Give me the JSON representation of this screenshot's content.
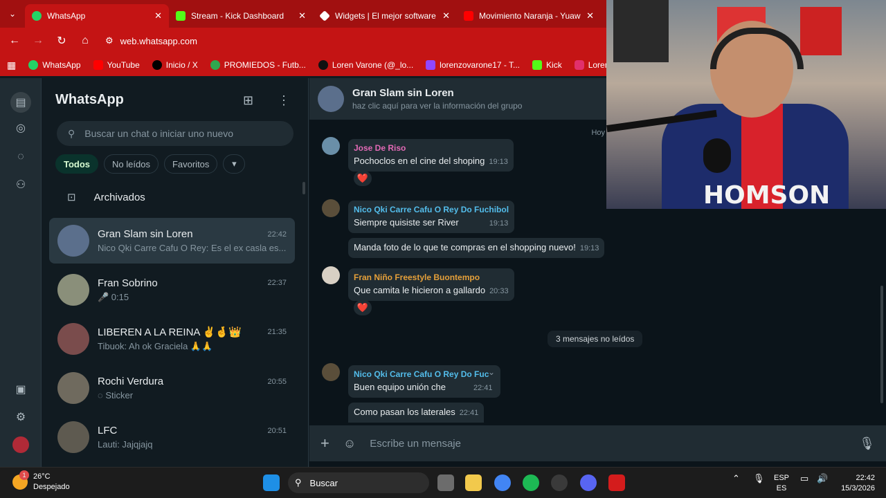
{
  "browser": {
    "tabs": [
      {
        "title": "WhatsApp",
        "color": "#25d366",
        "active": true
      },
      {
        "title": "Stream - Kick Dashboard",
        "color": "#53fc18",
        "active": false
      },
      {
        "title": "Widgets | El mejor software para ...",
        "color": "#ffffff",
        "active": false
      },
      {
        "title": "Movimiento Naranja - Yuawn...",
        "color": "#ff0000",
        "active": false
      }
    ],
    "close_glyph": "✕",
    "url": "web.whatsapp.com",
    "bookmarks": [
      {
        "label": "WhatsApp",
        "color": "#25d366"
      },
      {
        "label": "YouTube",
        "color": "#ff0000"
      },
      {
        "label": "Inicio / X",
        "color": "#000000"
      },
      {
        "label": "PROMIEDOS - Futb...",
        "color": "#2fa84f"
      },
      {
        "label": "Loren Varone (@_lo...",
        "color": "#111111"
      },
      {
        "label": "lorenzovarone17 - T...",
        "color": "#9146ff"
      },
      {
        "label": "Kick",
        "color": "#53fc18"
      },
      {
        "label": "Lorenzovaro",
        "color": "#e1306c"
      }
    ]
  },
  "sidebar": {
    "title": "WhatsApp",
    "search_placeholder": "Buscar un chat o iniciar uno nuevo",
    "filters": [
      "Todos",
      "No leídos",
      "Favoritos"
    ],
    "archived_label": "Archivados",
    "chats": [
      {
        "name": "Gran Slam sin Loren",
        "time": "22:42",
        "preview": "Nico Qki Carre Cafu O Rey: Es el ex casla es...",
        "avatar_color": "#5b6f8c"
      },
      {
        "name": "Fran Sobrino",
        "time": "22:37",
        "preview": "🎤 0:15",
        "avatar_color": "#8a8f7a"
      },
      {
        "name": "LIBEREN A LA REINA ✌️🤞👑",
        "time": "21:35",
        "preview": "Tibuok: Ah ok Graciela 🙏🙏",
        "avatar_color": "#7a4c4c"
      },
      {
        "name": "Rochi Verdura",
        "time": "20:55",
        "preview": "◌ Sticker",
        "avatar_color": "#6f6a5e"
      },
      {
        "name": "LFC",
        "time": "20:51",
        "preview": "Lauti: Jajqjajq",
        "avatar_color": "#5e5a50"
      }
    ]
  },
  "conversation": {
    "group_name": "Gran Slam sin Loren",
    "group_info": "haz clic aquí para ver la información del grupo",
    "day_label": "Hoy",
    "unread_label": "3 mensajes no leídos",
    "heart": "❤️",
    "messages": [
      {
        "sender": "Jose De Riso",
        "sender_color": "#e26ab6",
        "text": "Pochoclos en el cine del shoping",
        "time": "19:13"
      },
      {
        "sender": "Nico Qki Carre Cafu O Rey Do Fuchibol",
        "sender_color": "#53bdeb",
        "text": "Siempre quisiste ser River",
        "time": "19:13"
      },
      {
        "sender": "",
        "sender_color": "",
        "text": "Manda foto de lo que te compras en el shopping nuevo!",
        "time": "19:13"
      },
      {
        "sender": "Fran Niño Freestyle Buontempo",
        "sender_color": "#e5a03a",
        "text": "Que camita le hicieron a gallardo",
        "time": "20:33"
      },
      {
        "sender": "Nico Qki Carre Cafu O Rey Do Fuc",
        "sender_color": "#53bdeb",
        "text": "Buen equipo unión che",
        "time": "22:41"
      },
      {
        "sender": "",
        "sender_color": "",
        "text": "Como pasan los laterales",
        "time": "22:41"
      }
    ],
    "composer_placeholder": "Escribe un mensaje"
  },
  "webcam": {
    "shirt_text": "HOMSON"
  },
  "taskbar": {
    "weather_temp": "26°C",
    "weather_desc": "Despejado",
    "weather_badge": "1",
    "search_label": "Buscar",
    "lang_top": "ESP",
    "lang_bottom": "ES",
    "time": "22:42",
    "date": "15/3/2026"
  }
}
